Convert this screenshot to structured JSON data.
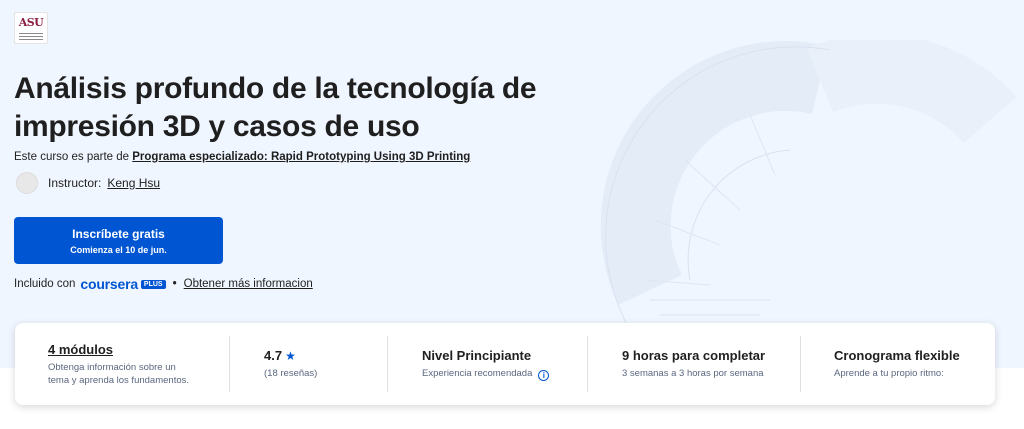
{
  "provider": {
    "logo_text": "ASU"
  },
  "course": {
    "title": "Análisis profundo de la tecnología de impresión 3D y casos de uso",
    "part_of_prefix": "Este curso es parte de",
    "program_link": "Programa especializado: Rapid Prototyping Using 3D Printing",
    "instructor_label": "Instructor:",
    "instructor_name": "Keng Hsu"
  },
  "enroll": {
    "label": "Inscríbete gratis",
    "sublabel": "Comienza el 10 de jun."
  },
  "included": {
    "prefix": "Incluido con",
    "brand": "coursera",
    "plus": "PLUS",
    "separator": "•",
    "more_info": "Obtener más informacion"
  },
  "stats": {
    "modules": {
      "title": "4 módulos",
      "subtitle": "Obtenga información sobre un tema y aprenda los fundamentos."
    },
    "rating": {
      "value": "4.7",
      "reviews": "(18 reseñas)"
    },
    "level": {
      "title": "Nivel Principiante",
      "subtitle": "Experiencia recomendada"
    },
    "duration": {
      "title": "9 horas para completar",
      "subtitle": "3 semanas a 3 horas por semana"
    },
    "schedule": {
      "title": "Cronograma flexible",
      "subtitle": "Aprende a tu propio ritmo:"
    }
  },
  "colors": {
    "brand_blue": "#0056d2",
    "hero_bg": "#f0f6ff",
    "asu_maroon": "#8c1d40"
  }
}
